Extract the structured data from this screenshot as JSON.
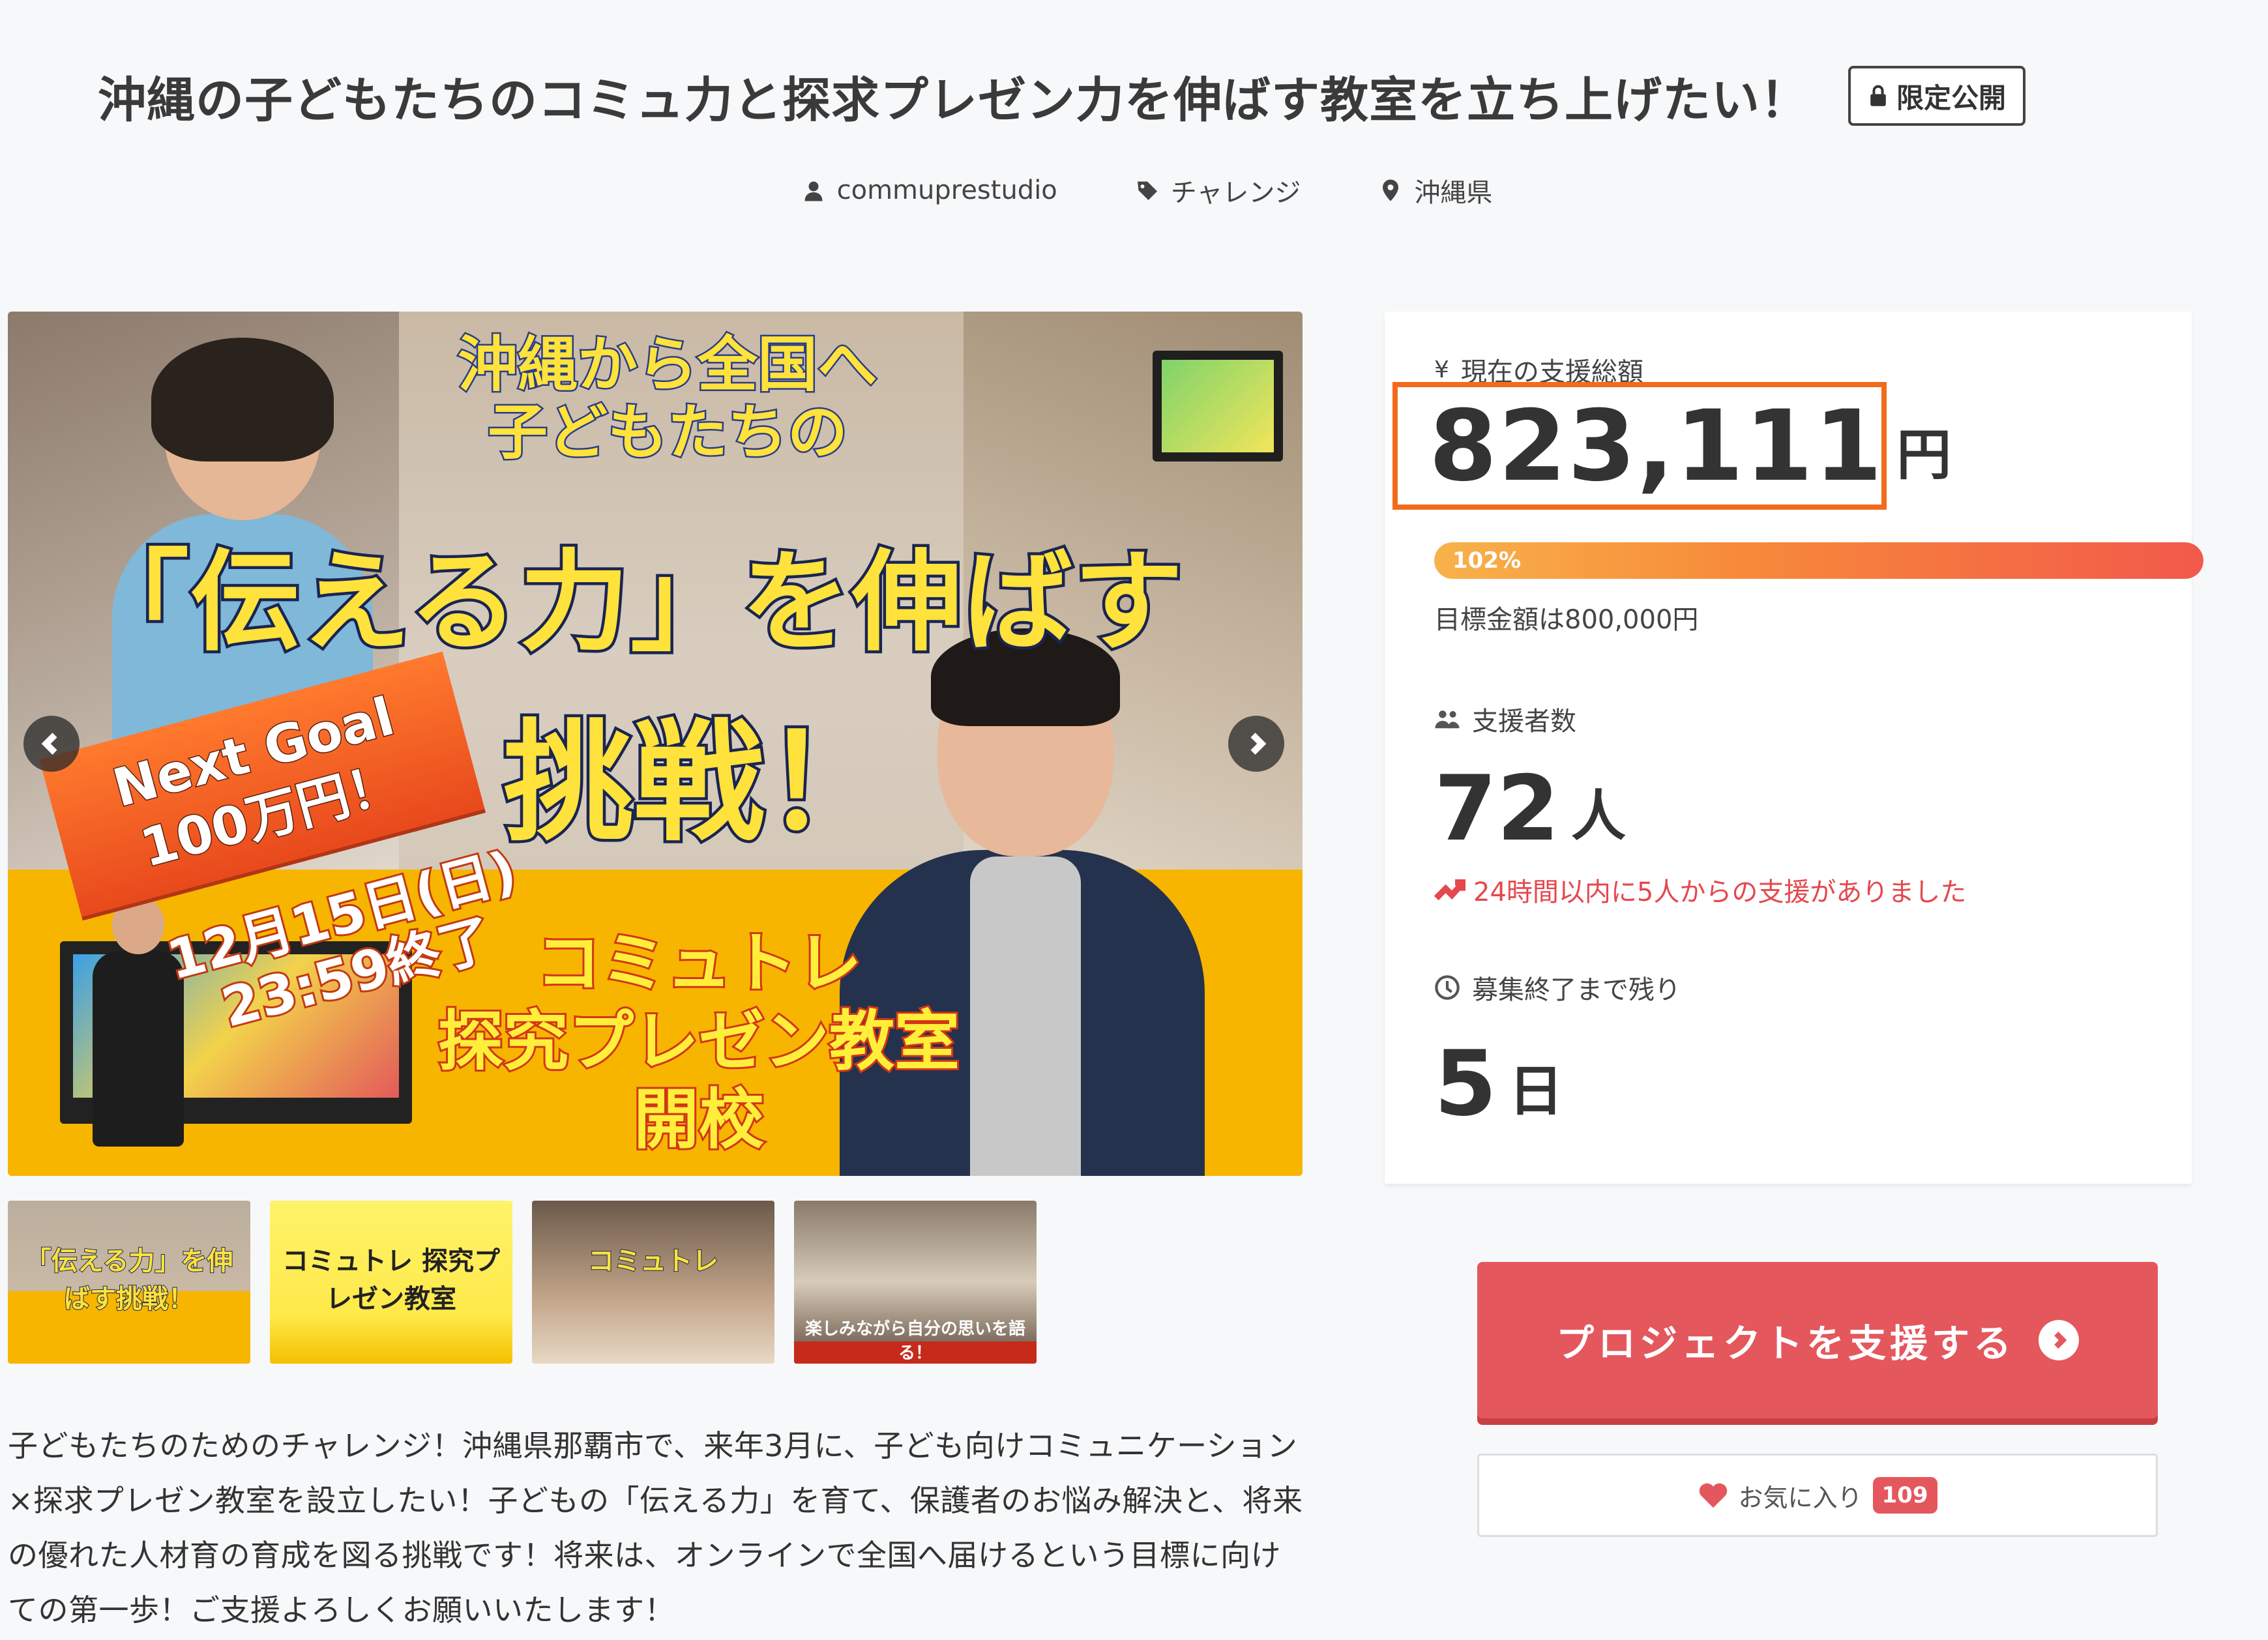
{
  "project": {
    "title": "沖縄の子どもたちのコミュ力と探求プレゼン力を伸ばす教室を立ち上げたい！",
    "visibility_badge": "限定公開",
    "owner": "commuprestudio",
    "category": "チャレンジ",
    "location": "沖縄県",
    "description": "子どもたちのためのチャレンジ！沖縄県那覇市で、来年3月に、子ども向けコミュニケーション×探求プレゼン教室を設立したい！子どもの「伝える力」を育て、保護者のお悩み解決と、将来の優れた人材育の育成を図る挑戦です！将来は、オンラインで全国へ届けるという目標に向けての第一歩！ご支援よろしくお願いいたします！"
  },
  "hero_image": {
    "line1": "沖縄から全国へ",
    "line2": "子どもたちの",
    "line3": "「伝える力」を伸ばす",
    "line4": "挑戦！",
    "ribbon_line1": "Next Goal",
    "ribbon_line2": "100万円！",
    "deadline_line1": "12月15日(日)",
    "deadline_line2": "23:59終了",
    "school_line1": "コミュトレ",
    "school_line2": "探究プレゼン教室",
    "school_line3": "開校"
  },
  "thumbnails": [
    {
      "caption": "「伝える力」を伸ばす挑戦！"
    },
    {
      "caption": "コミュトレ 探究プレゼン教室"
    },
    {
      "caption": "コミュトレ"
    },
    {
      "caption": "楽しみながら自分の思いを語る！"
    }
  ],
  "stats": {
    "total_label": "現在の支援総額",
    "total_amount": "823,111",
    "total_unit": "円",
    "progress_percent": 102,
    "progress_label": "102%",
    "goal_text": "目標金額は800,000円",
    "supporters_label": "支援者数",
    "supporters_count": "72",
    "supporters_unit": "人",
    "trend_text": "24時間以内に5人からの支援がありました",
    "remaining_label": "募集終了まで残り",
    "remaining_count": "5",
    "remaining_unit": "日"
  },
  "actions": {
    "support_label": "プロジェクトを支援する",
    "favorite_label": "お気に入り",
    "favorite_count": "109"
  },
  "icons": {
    "yen": "¥",
    "lock": "lock-icon",
    "user": "user-icon",
    "tag": "tag-icon",
    "pin": "map-pin-icon",
    "group": "group-icon",
    "trend": "trending-up-icon",
    "clock": "clock-icon",
    "heart": "heart-icon"
  },
  "colors": {
    "accent": "#e4575d",
    "highlight_box": "#f26b1d",
    "progress_start": "#f8b24a",
    "progress_end": "#f2594b"
  }
}
